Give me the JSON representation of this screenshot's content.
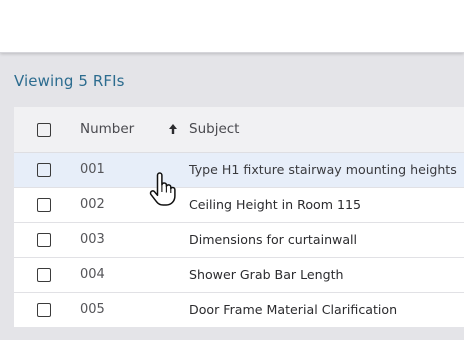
{
  "header": {
    "viewing_text": "Viewing 5 RFIs"
  },
  "table": {
    "columns": {
      "number": "Number",
      "subject": "Subject"
    },
    "sort_icon": "sort-ascending-arrow-icon",
    "rows": [
      {
        "number": "001",
        "subject": "Type H1 fixture stairway mounting heights"
      },
      {
        "number": "002",
        "subject": "Ceiling Height in Room 115"
      },
      {
        "number": "003",
        "subject": "Dimensions for curtainwall"
      },
      {
        "number": "004",
        "subject": "Shower Grab Bar Length"
      },
      {
        "number": "005",
        "subject": "Door Frame Material Clarification"
      }
    ],
    "hovered_row": "001"
  },
  "colors": {
    "accent_text": "#2c6c8f",
    "hover_row": "#e7eef9",
    "header_bg": "#f1f1f3",
    "page_bg": "#e4e4e8"
  },
  "cursor_icon": "hand-pointer-icon"
}
